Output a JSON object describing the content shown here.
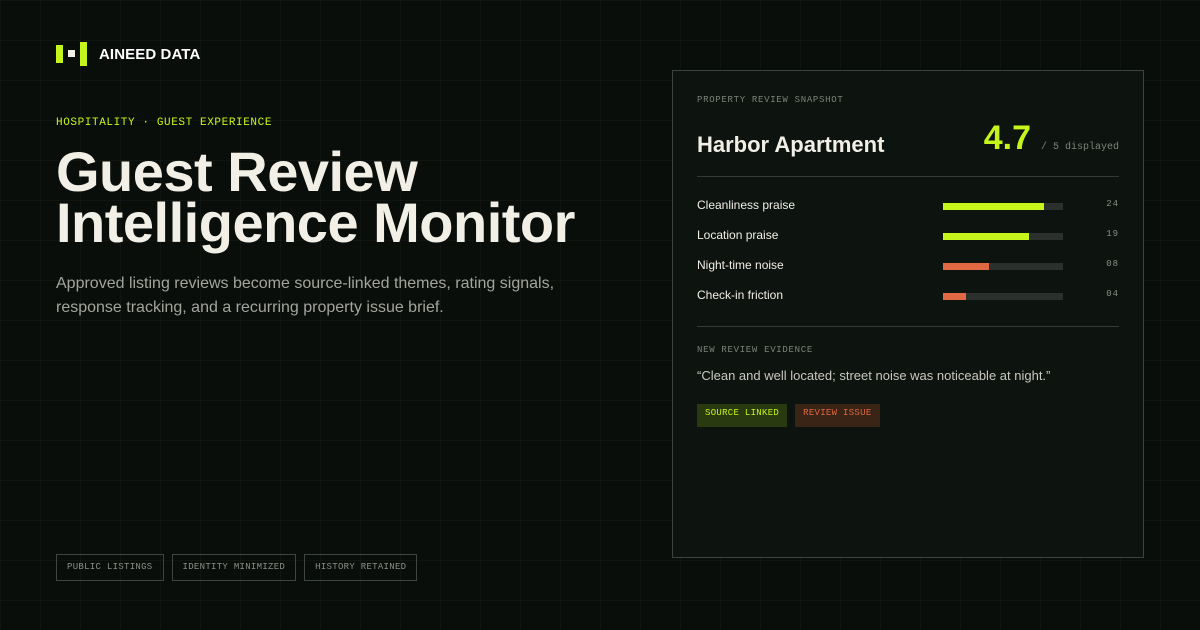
{
  "brand": {
    "name": "AINEED DATA"
  },
  "hero": {
    "eyebrow": "HOSPITALITY · GUEST EXPERIENCE",
    "title_line1": "Guest Review",
    "title_line2": "Intelligence Monitor",
    "subtitle": "Approved listing reviews become source-linked themes, rating signals, response tracking, and a recurring property issue brief."
  },
  "footer_chips": [
    "PUBLIC LISTINGS",
    "IDENTITY MINIMIZED",
    "HISTORY RETAINED"
  ],
  "card": {
    "eyebrow": "PROPERTY REVIEW SNAPSHOT",
    "property_name": "Harbor Apartment",
    "rating": "4.7",
    "rating_scale": "/ 5 displayed",
    "metrics": [
      {
        "label": "Cleanliness praise",
        "count": "24",
        "level": 0.84,
        "tone": "positive"
      },
      {
        "label": "Location praise",
        "count": "19",
        "level": 0.72,
        "tone": "positive"
      },
      {
        "label": "Night-time noise",
        "count": "08",
        "level": 0.38,
        "tone": "negative"
      },
      {
        "label": "Check-in friction",
        "count": "04",
        "level": 0.19,
        "tone": "negative"
      }
    ],
    "evidence_eyebrow": "NEW REVIEW EVIDENCE",
    "quote": "“Clean and well located; street noise was noticeable at night.”",
    "tags": [
      {
        "label": "SOURCE LINKED",
        "tone": "positive"
      },
      {
        "label": "REVIEW ISSUE",
        "tone": "negative"
      }
    ]
  },
  "colors": {
    "accent": "#c6f51b",
    "warning": "#e06843",
    "background": "#0a0e0b"
  }
}
